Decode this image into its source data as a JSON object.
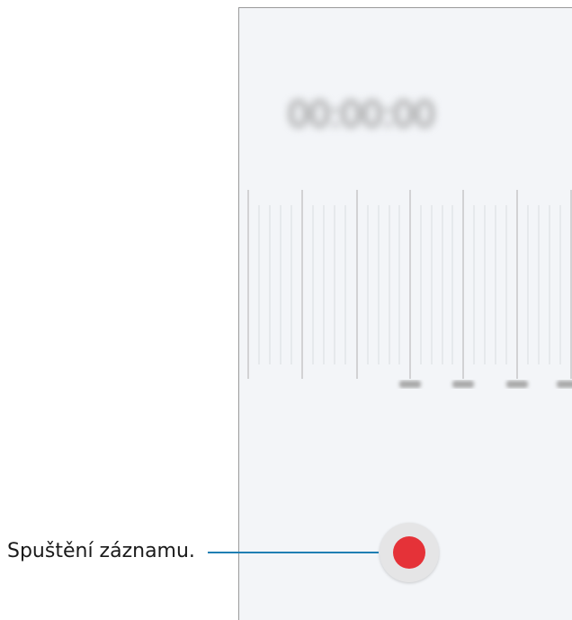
{
  "recorder": {
    "timer": "00:00:00"
  },
  "callout": {
    "text": "Spuštění záznamu."
  },
  "colors": {
    "record": "#e53238",
    "screen_bg": "#f3f5f8",
    "callout_line": "#1f7fb3"
  },
  "icons": {
    "record_button": "record-icon"
  }
}
